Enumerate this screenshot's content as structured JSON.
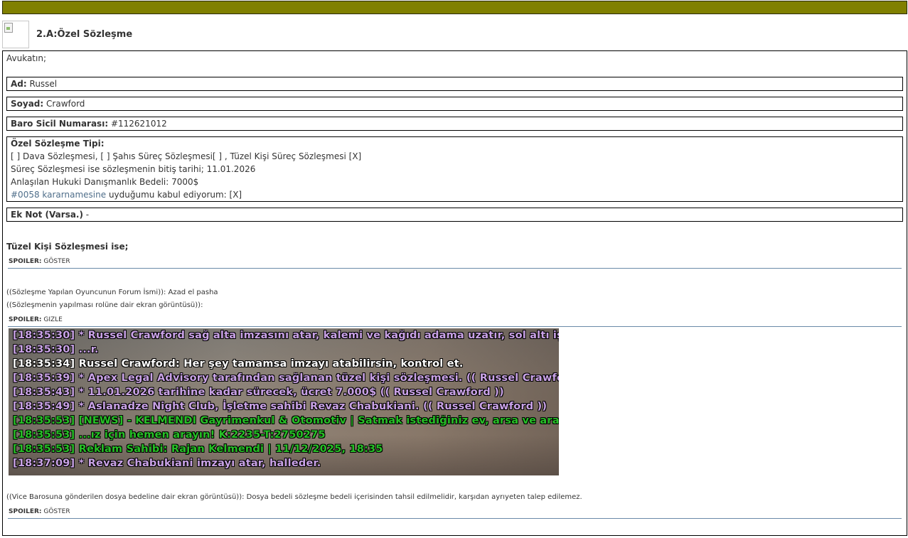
{
  "header": {
    "title": "2.A:Özel Sözleşme"
  },
  "intro": "Avukatın;",
  "fields": {
    "ad_label": "Ad:",
    "ad_value": "Russel",
    "soyad_label": "Soyad:",
    "soyad_value": "Crawford",
    "baro_label": "Baro Sicil Numarası:",
    "baro_value": "#112621012",
    "type_label": "Özel Sözleşme Tipi:",
    "type_line1": "[ ] Dava Sözleşmesi, [ ] Şahıs Süreç Sözleşmesi[ ] , Tüzel Kişi Süreç Sözleşmesi [X]",
    "type_line2": "Süreç Sözleşmesi ise sözleşmenin bitiş tarihi; 11.01.2026",
    "type_line3": "Anlaşılan Hukuki Danışmanlık Bedeli: 7000$",
    "type_line4_link": "#0058 kararnamesine",
    "type_line4_rest": " uyduğumu kabul ediyorum: [X]",
    "note_label": "Ek Not (Varsa.)",
    "note_value": " -"
  },
  "section_title": "Tüzel Kişi Sözleşmesi ise;",
  "spoilers": [
    {
      "label": "SPOILER:",
      "action": "GÖSTER"
    },
    {
      "label": "SPOILER:",
      "action": "GIZLE"
    },
    {
      "label": "SPOILER:",
      "action": "GÖSTER"
    }
  ],
  "forum_name_line": "((Sözleşme Yapılan Oyuncunun Forum İsmi)): Azad el pasha",
  "screenshot_caption": "((Sözleşmenin yapılması rolüne dair ekran görüntüsü)):",
  "fee_line": "((Vice Barosuna gönderilen dosya bedeline dair ekran görüntüsü)): Dosya bedeli sözleşme bedeli içerisinden tahsil edilmelidir, karşıdan ayrıyeten talep edilemez.",
  "chat_lines": [
    {
      "text": "[18:35:30] * Russel Crawford sağ alta imzasını atar, kalemi ve kağıdı adama uzatır, sol altı işaret ed",
      "color": "#c9a2e6"
    },
    {
      "text": "[18:35:30] ...r.",
      "color": "#c9a2e6"
    },
    {
      "text": "[18:35:34] Russel Crawford: Her şey tamamsa imzayı atabilirsin, kontrol et.",
      "color": "#ffffff"
    },
    {
      "text": "[18:35:39] * Apex Legal Advisory tarafından sağlanan tüzel kişi sözleşmesi. (( Russel Crawford ))",
      "color": "#c9a2e6"
    },
    {
      "text": "[18:35:43] * 11.01.2026 tarihine kadar sürecek, ücret 7.000$ (( Russel Crawford ))",
      "color": "#c9a2e6"
    },
    {
      "text": "[18:35:49] * Aslanadze Night Club, İşletme sahibi Revaz Chabukiani. (( Russel Crawford ))",
      "color": "#c9a2e6"
    },
    {
      "text": "[18:35:53] [NEWS] - KELMENDI Gayrimenkul & Otomotiv | Satmak istediğiniz ev, arsa ve araçların.",
      "color": "#26c026"
    },
    {
      "text": "[18:35:53] ...ız için hemen arayın! K:2235-T:2750275",
      "color": "#26c026"
    },
    {
      "text": "[18:35:53] Reklam Sahibi: Rajan Kelmendi | 11/12/2025, 18:35",
      "color": "#26c026"
    },
    {
      "text": "[18:37:09] * Revaz Chabukiani imzayı atar, halleder.",
      "color": "#c9a2e6"
    }
  ]
}
